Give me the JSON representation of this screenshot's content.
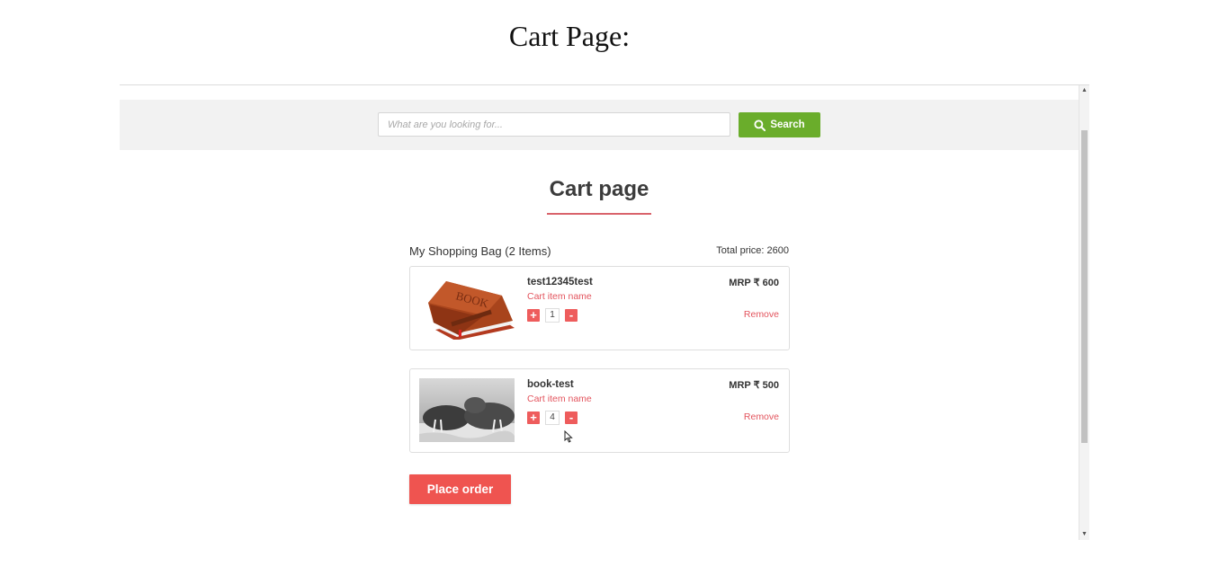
{
  "caption": "Cart Page:",
  "search": {
    "placeholder": "What are you looking for...",
    "button_label": "Search",
    "icon": "search-icon"
  },
  "page": {
    "title": "Cart page",
    "bag_summary": "My Shopping Bag (2 Items)",
    "total_price": "Total price: 2600"
  },
  "items": [
    {
      "name": "test12345test",
      "subtitle": "Cart item name",
      "quantity": "1",
      "price": "MRP ₹ 600",
      "remove_label": "Remove",
      "image": "brown-book-image"
    },
    {
      "name": "book-test",
      "subtitle": "Cart item name",
      "quantity": "4",
      "price": "MRP ₹ 500",
      "remove_label": "Remove",
      "image": "walrus-photo-image"
    }
  ],
  "controls": {
    "plus": "+",
    "minus": "-"
  },
  "place_order_label": "Place order",
  "colors": {
    "search_button": "#6aad2b",
    "accent_red": "#e3545d",
    "place_order": "#ef5450"
  }
}
